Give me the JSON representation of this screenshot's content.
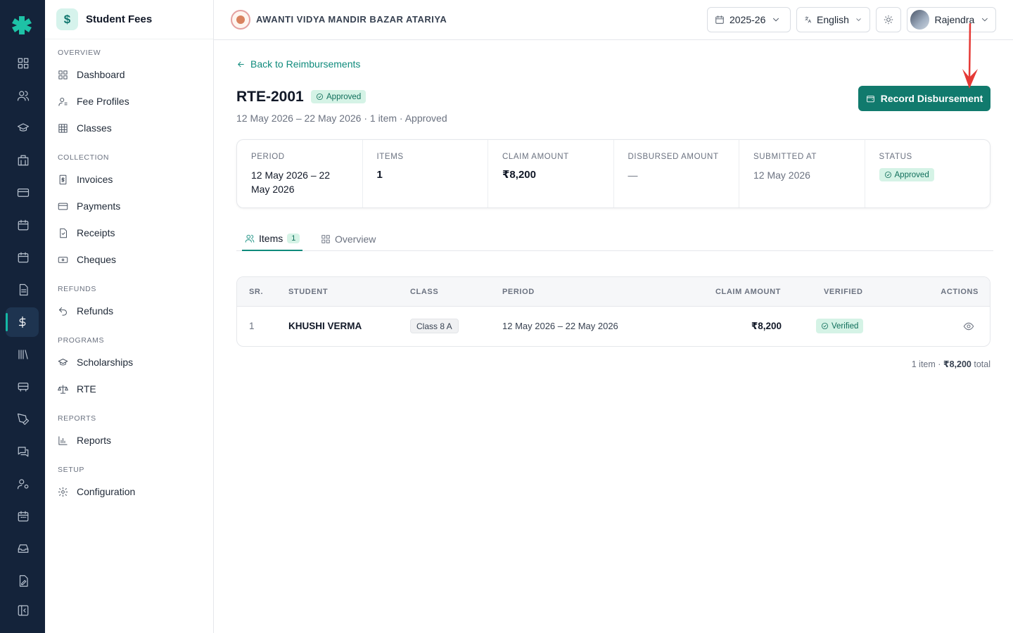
{
  "sidebar": {
    "title": "Student Fees",
    "sections": [
      {
        "label": "OVERVIEW",
        "items": [
          {
            "label": "Dashboard"
          },
          {
            "label": "Fee Profiles"
          },
          {
            "label": "Classes"
          }
        ]
      },
      {
        "label": "COLLECTION",
        "items": [
          {
            "label": "Invoices"
          },
          {
            "label": "Payments"
          },
          {
            "label": "Receipts"
          },
          {
            "label": "Cheques"
          }
        ]
      },
      {
        "label": "REFUNDS",
        "items": [
          {
            "label": "Refunds"
          }
        ]
      },
      {
        "label": "PROGRAMS",
        "items": [
          {
            "label": "Scholarships"
          },
          {
            "label": "RTE"
          }
        ]
      },
      {
        "label": "REPORTS",
        "items": [
          {
            "label": "Reports"
          }
        ]
      },
      {
        "label": "SETUP",
        "items": [
          {
            "label": "Configuration"
          }
        ]
      }
    ]
  },
  "topbar": {
    "school_name": "AWANTI VIDYA MANDIR BAZAR ATARIYA",
    "year": "2025-26",
    "language": "English",
    "user": "Rajendra"
  },
  "page": {
    "back_label": "Back to Reimbursements",
    "title": "RTE-2001",
    "status_badge": "Approved",
    "subtitle": "12 May 2026 – 22 May 2026 · 1 item · Approved",
    "primary_action": "Record Disbursement"
  },
  "summary": {
    "period_label": "PERIOD",
    "period_value": "12 May 2026 – 22 May 2026",
    "items_label": "ITEMS",
    "items_value": "1",
    "claim_label": "CLAIM AMOUNT",
    "claim_value": "₹8,200",
    "disbursed_label": "DISBURSED AMOUNT",
    "disbursed_value": "—",
    "submitted_label": "SUBMITTED AT",
    "submitted_value": "12 May 2026",
    "status_label": "STATUS",
    "status_value": "Approved"
  },
  "tabs": {
    "items_label": "Items",
    "items_count": "1",
    "overview_label": "Overview"
  },
  "table": {
    "headers": {
      "sr": "SR.",
      "student": "STUDENT",
      "class": "CLASS",
      "period": "PERIOD",
      "claim": "CLAIM AMOUNT",
      "verified": "VERIFIED",
      "actions": "ACTIONS"
    },
    "rows": [
      {
        "sr": "1",
        "student": "KHUSHI VERMA",
        "class": "Class 8 A",
        "period": "12 May 2026 – 22 May 2026",
        "claim": "₹8,200",
        "verified": "Verified"
      }
    ]
  },
  "footer": {
    "count_text": "1 item · ",
    "total_amount": "₹8,200",
    "total_suffix": " total"
  },
  "colors": {
    "accent": "#117a6d",
    "rail": "#14233a",
    "annotation": "#e53935"
  }
}
